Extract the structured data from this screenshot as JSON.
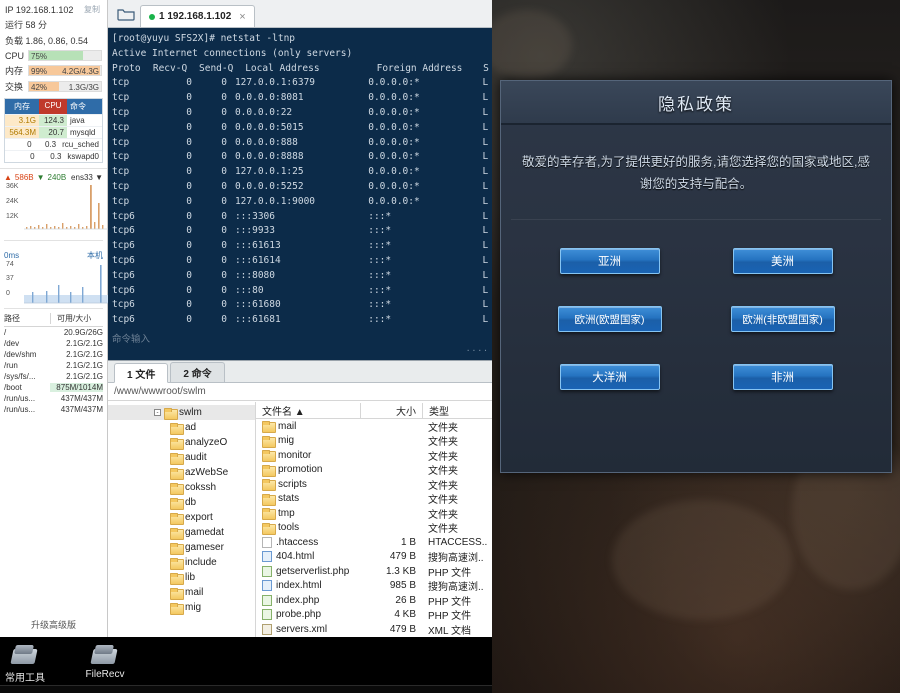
{
  "sidebar": {
    "ip_label": "IP 192.168.1.102",
    "copy_label": "复制",
    "uptime": "运行 58 分",
    "load": "负载 1.86, 0.86, 0.54",
    "meters": [
      {
        "name": "CPU",
        "pct": "75%",
        "value": "",
        "color": "#b7e1b7",
        "fillwidth": 75
      },
      {
        "name": "内存",
        "pct": "99%",
        "value": "4.2G/4.3G",
        "color": "#f7c89a",
        "fillwidth": 99
      },
      {
        "name": "交换",
        "pct": "42%",
        "value": "1.3G/3G",
        "color": "#f7c89a",
        "fillwidth": 42
      }
    ],
    "proc_headers": {
      "mem": "内存",
      "cpu": "CPU",
      "cmd": "命令"
    },
    "processes": [
      {
        "mem": "3.1G",
        "cpu": "124.3",
        "cmd": "java",
        "highlight": true
      },
      {
        "mem": "564.3M",
        "cpu": "20.7",
        "cmd": "mysqld",
        "highlight": true
      },
      {
        "mem": "0",
        "cpu": "0.3",
        "cmd": "rcu_sched",
        "highlight": false
      },
      {
        "mem": "0",
        "cpu": "0.3",
        "cmd": "kswapd0",
        "highlight": false
      }
    ],
    "net": {
      "up": "586B",
      "down": "240B",
      "interface": "ens33",
      "y_labels": [
        "36K",
        "24K",
        "12K"
      ]
    },
    "ping": {
      "top_label": "0ms",
      "corner_label": "本机",
      "y_labels": [
        "74",
        "37",
        "0"
      ]
    },
    "disk_headers": {
      "path": "路径",
      "usage": "可用/大小"
    },
    "disks": [
      {
        "path": "/",
        "usage": "20.9G/26G",
        "highlight": false
      },
      {
        "path": "/dev",
        "usage": "2.1G/2.1G",
        "highlight": false
      },
      {
        "path": "/dev/shm",
        "usage": "2.1G/2.1G",
        "highlight": false
      },
      {
        "path": "/run",
        "usage": "2.1G/2.1G",
        "highlight": false
      },
      {
        "path": "/sys/fs/...",
        "usage": "2.1G/2.1G",
        "highlight": false
      },
      {
        "path": "/boot",
        "usage": "875M/1014M",
        "highlight": true
      },
      {
        "path": "/run/us...",
        "usage": "437M/437M",
        "highlight": false
      },
      {
        "path": "/run/us...",
        "usage": "437M/437M",
        "highlight": false
      }
    ],
    "upgrade_label": "升级高级版"
  },
  "terminal": {
    "tab": {
      "label": "1 192.168.1.102",
      "close": "×"
    },
    "prompt_line": "[root@yuyu SFS2X]# netstat -ltnp",
    "header_line": "Active Internet connections (only servers)",
    "columns": {
      "proto": "Proto",
      "recvq": "Recv-Q",
      "sendq": "Send-Q",
      "local": "Local Address",
      "foreign": "Foreign Address",
      "state": "S"
    },
    "rows": [
      {
        "proto": "tcp",
        "recvq": "0",
        "sendq": "0",
        "local": "127.0.0.1:6379",
        "foreign": "0.0.0.0:*",
        "state": "L"
      },
      {
        "proto": "tcp",
        "recvq": "0",
        "sendq": "0",
        "local": "0.0.0.0:8081",
        "foreign": "0.0.0.0:*",
        "state": "L"
      },
      {
        "proto": "tcp",
        "recvq": "0",
        "sendq": "0",
        "local": "0.0.0.0:22",
        "foreign": "0.0.0.0:*",
        "state": "L"
      },
      {
        "proto": "tcp",
        "recvq": "0",
        "sendq": "0",
        "local": "0.0.0.0:5015",
        "foreign": "0.0.0.0:*",
        "state": "L"
      },
      {
        "proto": "tcp",
        "recvq": "0",
        "sendq": "0",
        "local": "0.0.0.0:888",
        "foreign": "0.0.0.0:*",
        "state": "L"
      },
      {
        "proto": "tcp",
        "recvq": "0",
        "sendq": "0",
        "local": "0.0.0.0:8888",
        "foreign": "0.0.0.0:*",
        "state": "L"
      },
      {
        "proto": "tcp",
        "recvq": "0",
        "sendq": "0",
        "local": "127.0.0.1:25",
        "foreign": "0.0.0.0:*",
        "state": "L"
      },
      {
        "proto": "tcp",
        "recvq": "0",
        "sendq": "0",
        "local": "0.0.0.0:5252",
        "foreign": "0.0.0.0:*",
        "state": "L"
      },
      {
        "proto": "tcp",
        "recvq": "0",
        "sendq": "0",
        "local": "127.0.0.1:9000",
        "foreign": "0.0.0.0:*",
        "state": "L"
      },
      {
        "proto": "tcp6",
        "recvq": "0",
        "sendq": "0",
        "local": ":::3306",
        "foreign": ":::*",
        "state": "L"
      },
      {
        "proto": "tcp6",
        "recvq": "0",
        "sendq": "0",
        "local": ":::9933",
        "foreign": ":::*",
        "state": "L"
      },
      {
        "proto": "tcp6",
        "recvq": "0",
        "sendq": "0",
        "local": ":::61613",
        "foreign": ":::*",
        "state": "L"
      },
      {
        "proto": "tcp6",
        "recvq": "0",
        "sendq": "0",
        "local": ":::61614",
        "foreign": ":::*",
        "state": "L"
      },
      {
        "proto": "tcp6",
        "recvq": "0",
        "sendq": "0",
        "local": ":::8080",
        "foreign": ":::*",
        "state": "L"
      },
      {
        "proto": "tcp6",
        "recvq": "0",
        "sendq": "0",
        "local": ":::80",
        "foreign": ":::*",
        "state": "L"
      },
      {
        "proto": "tcp6",
        "recvq": "0",
        "sendq": "0",
        "local": ":::61680",
        "foreign": ":::*",
        "state": "L"
      },
      {
        "proto": "tcp6",
        "recvq": "0",
        "sendq": "0",
        "local": ":::61681",
        "foreign": ":::*",
        "state": "L"
      }
    ],
    "command_input_placeholder": "命令输入"
  },
  "file_manager": {
    "tabs": [
      {
        "label": "1 文件",
        "active": true
      },
      {
        "label": "2 命令",
        "active": false
      }
    ],
    "path": "/www/wwwroot/swlm",
    "tree_root": "swlm",
    "tree_items": [
      "ad",
      "analyzeO",
      "audit",
      "azWebSe",
      "cokssh",
      "db",
      "export",
      "gamedat",
      "gameser",
      "include",
      "lib",
      "mail",
      "mig"
    ],
    "list_headers": {
      "name": "文件名",
      "sort": "▲",
      "size": "大小",
      "type": "类型"
    },
    "files": [
      {
        "name": "mail",
        "size": "",
        "type": "文件夹",
        "kind": "folder"
      },
      {
        "name": "mig",
        "size": "",
        "type": "文件夹",
        "kind": "folder"
      },
      {
        "name": "monitor",
        "size": "",
        "type": "文件夹",
        "kind": "folder"
      },
      {
        "name": "promotion",
        "size": "",
        "type": "文件夹",
        "kind": "folder"
      },
      {
        "name": "scripts",
        "size": "",
        "type": "文件夹",
        "kind": "folder"
      },
      {
        "name": "stats",
        "size": "",
        "type": "文件夹",
        "kind": "folder"
      },
      {
        "name": "tmp",
        "size": "",
        "type": "文件夹",
        "kind": "folder"
      },
      {
        "name": "tools",
        "size": "",
        "type": "文件夹",
        "kind": "folder"
      },
      {
        "name": ".htaccess",
        "size": "1 B",
        "type": "HTACCESS..",
        "kind": "file"
      },
      {
        "name": "404.html",
        "size": "479 B",
        "type": "搜狗高速浏..",
        "kind": "html"
      },
      {
        "name": "getserverlist.php",
        "size": "1.3 KB",
        "type": "PHP 文件",
        "kind": "php"
      },
      {
        "name": "index.html",
        "size": "985 B",
        "type": "搜狗高速浏..",
        "kind": "html"
      },
      {
        "name": "index.php",
        "size": "26 B",
        "type": "PHP 文件",
        "kind": "php"
      },
      {
        "name": "probe.php",
        "size": "4 KB",
        "type": "PHP 文件",
        "kind": "php"
      },
      {
        "name": "servers.xml",
        "size": "479 B",
        "type": "XML 文档",
        "kind": "xml"
      }
    ]
  },
  "game_dialog": {
    "title": "隐私政策",
    "message": "敬爱的幸存者,为了提供更好的服务,请您选择您的国家或地区,感谢您的支持与配合。",
    "buttons": [
      {
        "label": "亚洲",
        "wide": false
      },
      {
        "label": "美洲",
        "wide": false
      },
      {
        "label": "欧洲(欧盟国家)",
        "wide": true
      },
      {
        "label": "欧洲(非欧盟国家)",
        "wide": true
      },
      {
        "label": "大洋洲",
        "wide": false
      },
      {
        "label": "非洲",
        "wide": false
      }
    ]
  },
  "taskbar": {
    "items": [
      {
        "label": "常用工具"
      },
      {
        "label": "FileRecv"
      }
    ]
  },
  "colors": {
    "terminal_bg": "#0c2b49",
    "accent_blue": "#2f6ca8",
    "cpu_red": "#c0392b",
    "game_button_blue": "#2573c0"
  }
}
